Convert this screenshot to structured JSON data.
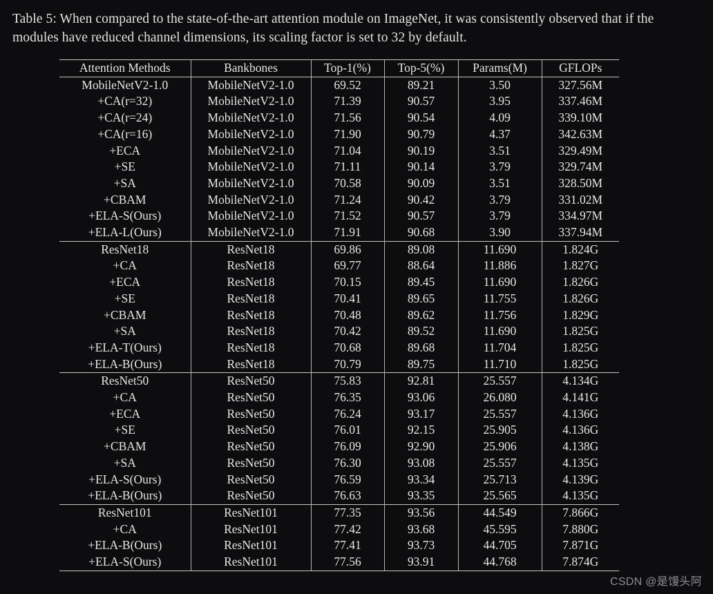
{
  "caption": "Table 5: When compared to the state-of-the-art attention module on ImageNet, it was consistently observed that if the modules have reduced channel dimensions, its scaling factor is set to 32 by default.",
  "watermark": "CSDN @是馒头阿",
  "colors": {
    "background": "#0d0d0f",
    "text": "#e8e6e3",
    "rule": "#c9c7c4",
    "watermark_text": "#8f8f92"
  },
  "table": {
    "headers": [
      "Attention Methods",
      "Bankbones",
      "Top-1(%)",
      "Top-5(%)",
      "Params(M)",
      "GFLOPs"
    ],
    "blocks": [
      {
        "name": "mobilenetv2-block",
        "rows": [
          {
            "method": "MobileNetV2-1.0",
            "backbone": "MobileNetV2-1.0",
            "top1": "69.52",
            "top5": "89.21",
            "params": "3.50",
            "gflops": "327.56M",
            "bold": []
          },
          {
            "method": "+CA(r=32)",
            "backbone": "MobileNetV2-1.0",
            "top1": "71.39",
            "top5": "90.57",
            "params": "3.95",
            "gflops": "337.46M",
            "bold": []
          },
          {
            "method": "+CA(r=24)",
            "backbone": "MobileNetV2-1.0",
            "top1": "71.56",
            "top5": "90.54",
            "params": "4.09",
            "gflops": "339.10M",
            "bold": []
          },
          {
            "method": "+CA(r=16)",
            "backbone": "MobileNetV2-1.0",
            "top1": "71.90",
            "top5": "90.79",
            "params": "4.37",
            "gflops": "342.63M",
            "bold": [
              "top5"
            ]
          },
          {
            "method": "+ECA",
            "backbone": "MobileNetV2-1.0",
            "top1": "71.04",
            "top5": "90.19",
            "params": "3.51",
            "gflops": "329.49M",
            "bold": [
              "params"
            ]
          },
          {
            "method": "+SE",
            "backbone": "MobileNetV2-1.0",
            "top1": "71.11",
            "top5": "90.14",
            "params": "3.79",
            "gflops": "329.74M",
            "bold": []
          },
          {
            "method": "+SA",
            "backbone": "MobileNetV2-1.0",
            "top1": "70.58",
            "top5": "90.09",
            "params": "3.51",
            "gflops": "328.50M",
            "bold": [
              "params",
              "gflops"
            ]
          },
          {
            "method": "+CBAM",
            "backbone": "MobileNetV2-1.0",
            "top1": "71.24",
            "top5": "90.42",
            "params": "3.79",
            "gflops": "331.02M",
            "bold": []
          },
          {
            "method": "+ELA-S(Ours)",
            "backbone": "MobileNetV2-1.0",
            "top1": "71.52",
            "top5": "90.57",
            "params": "3.79",
            "gflops": "334.97M",
            "bold": []
          },
          {
            "method": "+ELA-L(Ours)",
            "backbone": "MobileNetV2-1.0",
            "top1": "71.91",
            "top5": "90.68",
            "params": "3.90",
            "gflops": "337.94M",
            "bold": [
              "top1"
            ]
          }
        ]
      },
      {
        "name": "resnet18-block",
        "rows": [
          {
            "method": "ResNet18",
            "backbone": "ResNet18",
            "top1": "69.86",
            "top5": "89.08",
            "params": "11.690",
            "gflops": "1.824G",
            "bold": []
          },
          {
            "method": "+CA",
            "backbone": "ResNet18",
            "top1": "69.77",
            "top5": "88.64",
            "params": "11.886",
            "gflops": "1.827G",
            "bold": []
          },
          {
            "method": "+ECA",
            "backbone": "ResNet18",
            "top1": "70.15",
            "top5": "89.45",
            "params": "11.690",
            "gflops": "1.826G",
            "bold": [
              "params"
            ]
          },
          {
            "method": "+SE",
            "backbone": "ResNet18",
            "top1": "70.41",
            "top5": "89.65",
            "params": "11.755",
            "gflops": "1.826G",
            "bold": []
          },
          {
            "method": "+CBAM",
            "backbone": "ResNet18",
            "top1": "70.48",
            "top5": "89.62",
            "params": "11.756",
            "gflops": "1.829G",
            "bold": []
          },
          {
            "method": "+SA",
            "backbone": "ResNet18",
            "top1": "70.42",
            "top5": "89.52",
            "params": "11.690",
            "gflops": "1.825G",
            "bold": [
              "gflops"
            ]
          },
          {
            "method": "+ELA-T(Ours)",
            "backbone": "ResNet18",
            "top1": "70.68",
            "top5": "89.68",
            "params": "11.704",
            "gflops": "1.825G",
            "bold": [
              "gflops"
            ]
          },
          {
            "method": "+ELA-B(Ours)",
            "backbone": "ResNet18",
            "top1": "70.79",
            "top5": "89.75",
            "params": "11.710",
            "gflops": "1.825G",
            "bold": [
              "top1",
              "top5",
              "gflops"
            ]
          }
        ]
      },
      {
        "name": "resnet50-block",
        "rows": [
          {
            "method": "ResNet50",
            "backbone": "ResNet50",
            "top1": "75.83",
            "top5": "92.81",
            "params": "25.557",
            "gflops": "4.134G",
            "bold": []
          },
          {
            "method": "+CA",
            "backbone": "ResNet50",
            "top1": "76.35",
            "top5": "93.06",
            "params": "26.080",
            "gflops": "4.141G",
            "bold": []
          },
          {
            "method": "+ECA",
            "backbone": "ResNet50",
            "top1": "76.24",
            "top5": "93.17",
            "params": "25.557",
            "gflops": "4.136G",
            "bold": []
          },
          {
            "method": "+SE",
            "backbone": "ResNet50",
            "top1": "76.01",
            "top5": "92.15",
            "params": "25.905",
            "gflops": "4.136G",
            "bold": []
          },
          {
            "method": "+CBAM",
            "backbone": "ResNet50",
            "top1": "76.09",
            "top5": "92.90",
            "params": "25.906",
            "gflops": "4.138G",
            "bold": []
          },
          {
            "method": "+SA",
            "backbone": "ResNet50",
            "top1": "76.30",
            "top5": "93.08",
            "params": "25.557",
            "gflops": "4.135G",
            "bold": [
              "params",
              "gflops"
            ]
          },
          {
            "method": "+ELA-S(Ours)",
            "backbone": "ResNet50",
            "top1": "76.59",
            "top5": "93.34",
            "params": "25.713",
            "gflops": "4.139G",
            "bold": []
          },
          {
            "method": "+ELA-B(Ours)",
            "backbone": "ResNet50",
            "top1": "76.63",
            "top5": "93.35",
            "params": "25.565",
            "gflops": "4.135G",
            "bold": [
              "top1",
              "top5",
              "gflops"
            ]
          }
        ]
      },
      {
        "name": "resnet101-block",
        "rows": [
          {
            "method": "ResNet101",
            "backbone": "ResNet101",
            "top1": "77.35",
            "top5": "93.56",
            "params": "44.549",
            "gflops": "7.866G",
            "bold": []
          },
          {
            "method": "+CA",
            "backbone": "ResNet101",
            "top1": "77.42",
            "top5": "93.68",
            "params": "45.595",
            "gflops": "7.880G",
            "bold": []
          },
          {
            "method": "+ELA-B(Ours)",
            "backbone": "ResNet101",
            "top1": "77.41",
            "top5": "93.73",
            "params": "44.705",
            "gflops": "7.871G",
            "bold": [
              "params",
              "gflops"
            ]
          },
          {
            "method": "+ELA-S(Ours)",
            "backbone": "ResNet101",
            "top1": "77.56",
            "top5": "93.91",
            "params": "44.768",
            "gflops": "7.874G",
            "bold": [
              "top1",
              "top5"
            ]
          }
        ]
      }
    ]
  }
}
